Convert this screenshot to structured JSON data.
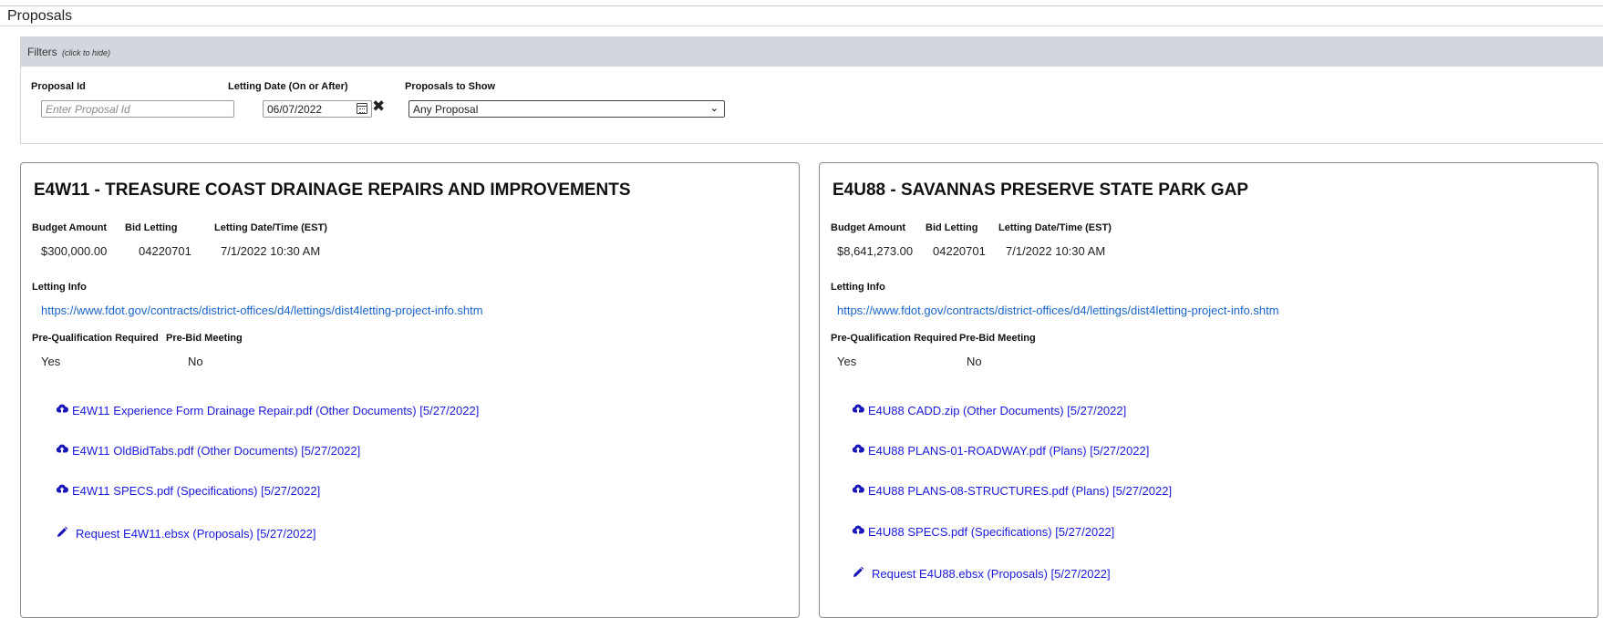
{
  "page": {
    "title": "Proposals"
  },
  "filters": {
    "header": "Filters",
    "hint": "(click to hide)",
    "proposal_id_label": "Proposal Id",
    "proposal_id_value": "",
    "proposal_id_placeholder": "Enter Proposal Id",
    "letting_date_label": "Letting Date (On or After)",
    "letting_date_value": "06/07/2022",
    "show_label": "Proposals to Show",
    "show_value": "Any Proposal"
  },
  "labels": {
    "budget": "Budget Amount",
    "bid_letting": "Bid Letting",
    "letting_time": "Letting Date/Time (EST)",
    "letting_info": "Letting Info",
    "prequal": "Pre-Qualification Required",
    "prebid": "Pre-Bid Meeting"
  },
  "proposals": [
    {
      "title": "E4W11 - TREASURE COAST DRAINAGE REPAIRS AND IMPROVEMENTS",
      "budget": "$300,000.00",
      "bid_letting": "04220701",
      "letting_time": "7/1/2022 10:30 AM",
      "letting_info_url": "https://www.fdot.gov/contracts/district-offices/d4/lettings/dist4letting-project-info.shtm",
      "prequal": "Yes",
      "prebid": "No",
      "documents": [
        {
          "text": "E4W11 Experience Form Drainage Repair.pdf (Other Documents) [5/27/2022]",
          "icon": "cloud-download-icon"
        },
        {
          "text": "E4W11 OldBidTabs.pdf (Other Documents) [5/27/2022]",
          "icon": "cloud-download-icon"
        },
        {
          "text": "E4W11 SPECS.pdf (Specifications) [5/27/2022]",
          "icon": "cloud-download-icon"
        },
        {
          "text": "Request E4W11.ebsx (Proposals) [5/27/2022]",
          "icon": "pencil-icon"
        }
      ]
    },
    {
      "title": "E4U88 - SAVANNAS PRESERVE STATE PARK GAP",
      "budget": "$8,641,273.00",
      "bid_letting": "04220701",
      "letting_time": "7/1/2022 10:30 AM",
      "letting_info_url": "https://www.fdot.gov/contracts/district-offices/d4/lettings/dist4letting-project-info.shtm",
      "prequal": "Yes",
      "prebid": "No",
      "documents": [
        {
          "text": "E4U88 CADD.zip (Other Documents) [5/27/2022]",
          "icon": "cloud-download-icon"
        },
        {
          "text": "E4U88 PLANS-01-ROADWAY.pdf (Plans) [5/27/2022]",
          "icon": "cloud-download-icon"
        },
        {
          "text": "E4U88 PLANS-08-STRUCTURES.pdf (Plans) [5/27/2022]",
          "icon": "cloud-download-icon"
        },
        {
          "text": "E4U88 SPECS.pdf (Specifications) [5/27/2022]",
          "icon": "cloud-download-icon"
        },
        {
          "text": "Request E4U88.ebsx (Proposals) [5/27/2022]",
          "icon": "pencil-icon"
        }
      ]
    }
  ]
}
